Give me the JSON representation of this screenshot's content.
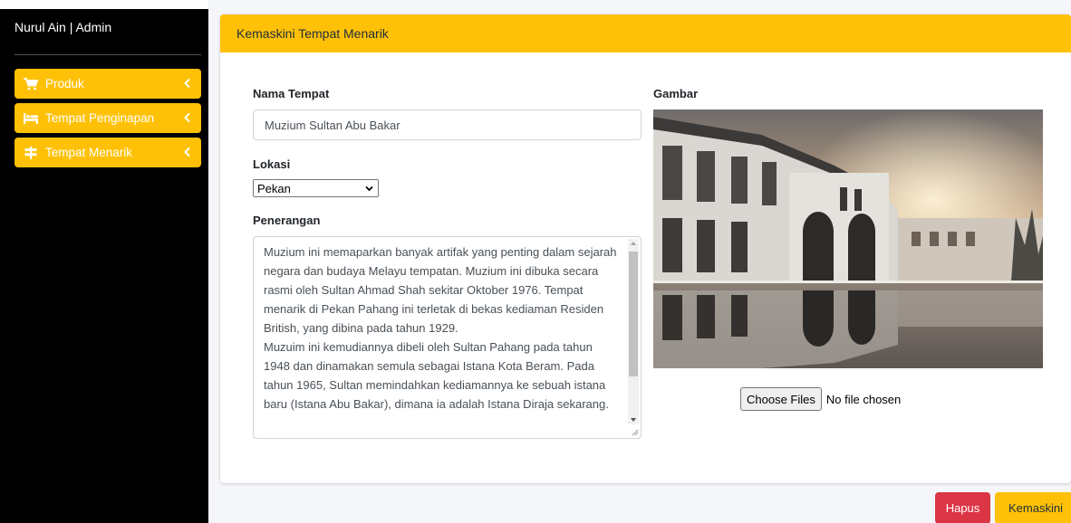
{
  "sidebar": {
    "brand": "Nurul Ain | Admin",
    "items": [
      {
        "label": "Produk",
        "icon": "cart-icon"
      },
      {
        "label": "Tempat Penginapan",
        "icon": "bed-icon"
      },
      {
        "label": "Tempat Menarik",
        "icon": "signpost-icon"
      }
    ]
  },
  "card": {
    "title": "Kemaskini Tempat Menarik",
    "nama": {
      "label": "Nama Tempat",
      "value": "Muzium Sultan Abu Bakar"
    },
    "lokasi": {
      "label": "Lokasi",
      "selected": "Pekan"
    },
    "penerangan": {
      "label": "Penerangan",
      "value": "Muzium ini memaparkan banyak artifak yang penting dalam sejarah negara dan budaya Melayu tempatan. Muzium ini dibuka secara rasmi oleh Sultan Ahmad Shah sekitar Oktober 1976. Tempat menarik di Pekan Pahang ini terletak di bekas kediaman Residen British, yang dibina pada tahun 1929.\nMuzuim ini kemudiannya dibeli oleh Sultan Pahang pada tahun 1948 dan dinamakan semula sebagai Istana Kota Beram. Pada tahun 1965, Sultan memindahkan kediamannya ke sebuah istana baru (Istana Abu Bakar), dimana ia adalah Istana Diraja sekarang."
    },
    "gambar": {
      "label": "Gambar",
      "choose_label": "Choose Files",
      "file_status": "No file chosen"
    }
  },
  "actions": {
    "delete_label": "Hapus",
    "update_label": "Kemaskini"
  },
  "colors": {
    "accent": "#ffc107",
    "danger": "#dc3545",
    "sidebar_bg": "#000000"
  }
}
